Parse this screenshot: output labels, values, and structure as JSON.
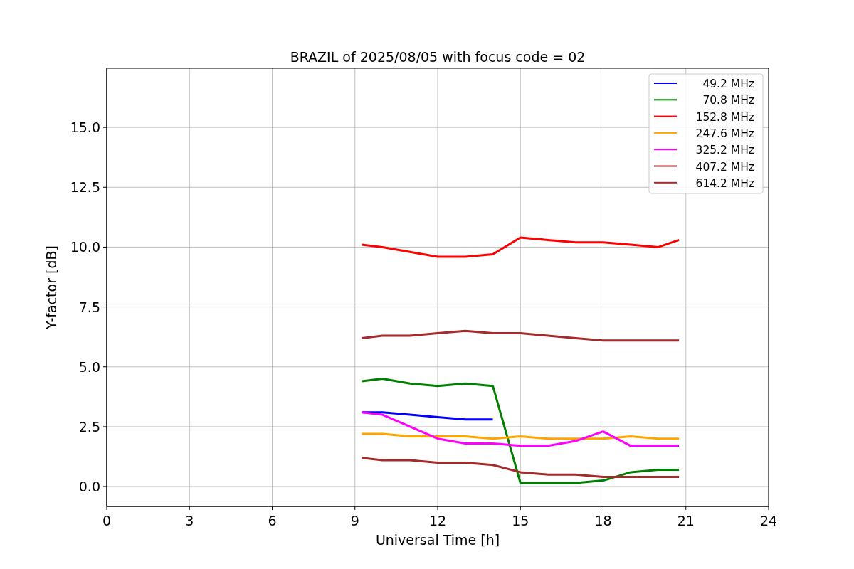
{
  "figure": {
    "chart_data": {
      "type": "line",
      "title": "BRAZIL of 2025/08/05 with focus code = 02",
      "xlabel": "Universal Time [h]",
      "ylabel": "Y-factor [dB]",
      "x": [
        9.25,
        10,
        11,
        12,
        13,
        14,
        15,
        16,
        17,
        18,
        19,
        20,
        20.75
      ],
      "series": [
        {
          "name": "49.2 MHz",
          "color": "#0000ff",
          "values": [
            3.1,
            3.1,
            3.0,
            2.9,
            2.8,
            2.8,
            null,
            null,
            null,
            null,
            null,
            null,
            null
          ]
        },
        {
          "name": "70.8 MHz",
          "color": "#008000",
          "values": [
            4.4,
            4.5,
            4.3,
            4.2,
            4.3,
            4.2,
            0.15,
            0.15,
            0.15,
            0.25,
            0.6,
            0.7,
            0.7
          ]
        },
        {
          "name": "152.8 MHz",
          "color": "#ff0000",
          "values": [
            10.1,
            10.0,
            9.8,
            9.6,
            9.6,
            9.7,
            10.4,
            10.3,
            10.2,
            10.2,
            10.1,
            10.0,
            10.3
          ]
        },
        {
          "name": "247.6 MHz",
          "color": "#ffa500",
          "values": [
            2.2,
            2.2,
            2.1,
            2.1,
            2.1,
            2.0,
            2.1,
            2.0,
            2.0,
            2.0,
            2.1,
            2.0,
            2.0
          ]
        },
        {
          "name": "325.2 MHz",
          "color": "#ff00ff",
          "values": [
            3.1,
            3.0,
            2.5,
            2.0,
            1.8,
            1.8,
            1.7,
            1.7,
            1.9,
            2.3,
            1.7,
            1.7,
            1.7
          ]
        },
        {
          "name": "407.2 MHz",
          "color": "#a52a2a",
          "values": [
            6.2,
            6.3,
            6.3,
            6.4,
            6.5,
            6.4,
            6.4,
            6.3,
            6.2,
            6.1,
            6.1,
            6.1,
            6.1
          ]
        },
        {
          "name": "614.2 MHz",
          "color": "#a52a2a",
          "values": [
            1.2,
            1.1,
            1.1,
            1.0,
            1.0,
            0.9,
            0.6,
            0.5,
            0.5,
            0.4,
            0.4,
            0.4,
            0.4
          ]
        }
      ],
      "grid": true,
      "legend": true,
      "xlim": [
        0,
        24
      ],
      "ylim": [
        -0.83,
        17.47
      ],
      "xticks": [
        0,
        3,
        6,
        9,
        12,
        15,
        18,
        21,
        24
      ],
      "yticks": [
        {
          "value": 0,
          "label": "0.0"
        },
        {
          "value": 2.5,
          "label": "2.5"
        },
        {
          "value": 5,
          "label": "5.0"
        },
        {
          "value": 7.5,
          "label": "7.5"
        },
        {
          "value": 10,
          "label": "10.0"
        },
        {
          "value": 12.5,
          "label": "12.5"
        },
        {
          "value": 15,
          "label": "15.0"
        }
      ]
    }
  }
}
